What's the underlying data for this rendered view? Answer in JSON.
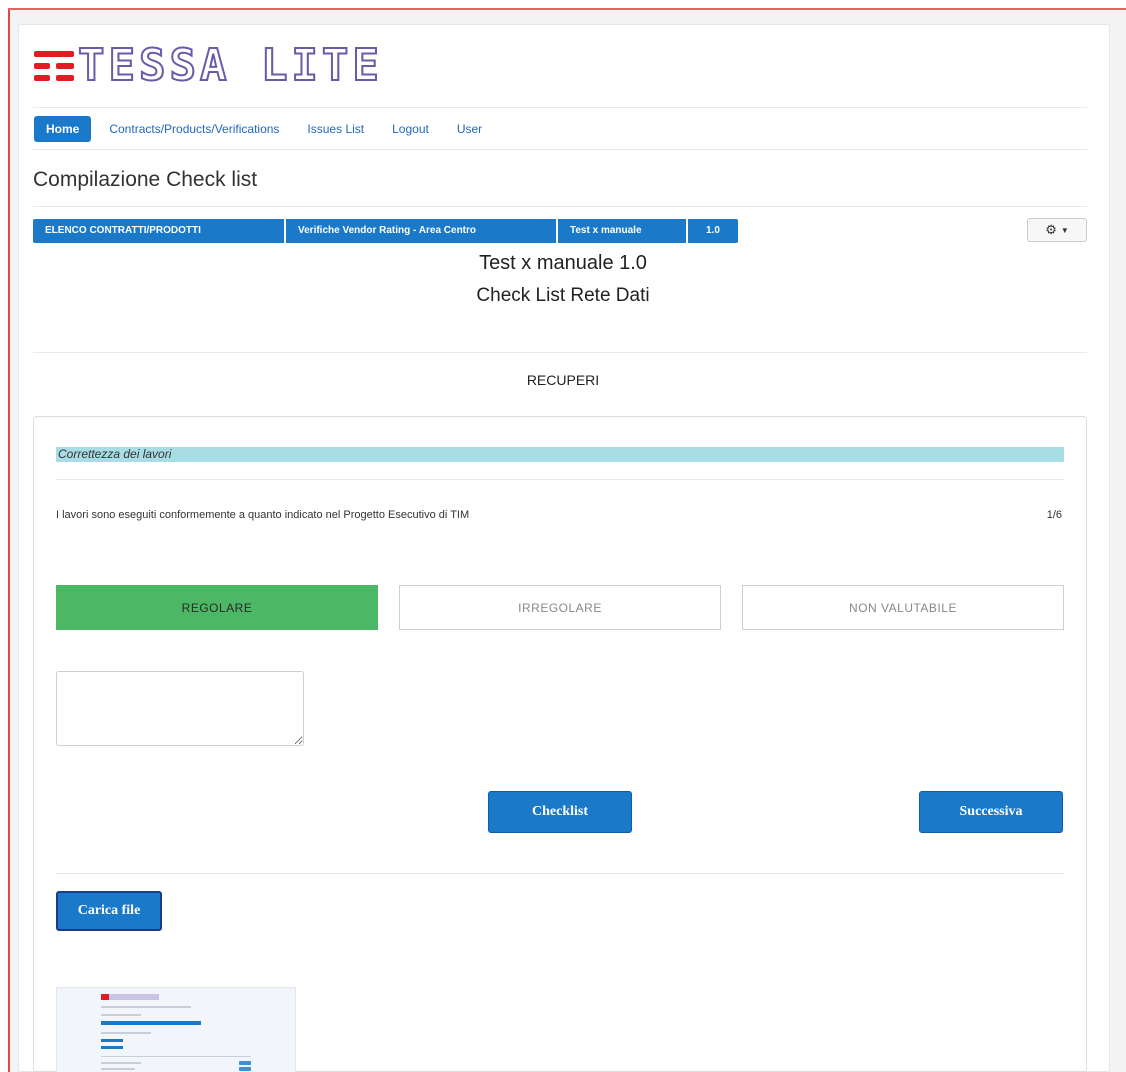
{
  "logo": {
    "text": "TESSA LITE",
    "icon": "tim-stripes-icon"
  },
  "nav": {
    "items": [
      {
        "label": "Home",
        "active": true
      },
      {
        "label": "Contracts/Products/Verifications",
        "active": false
      },
      {
        "label": "Issues List",
        "active": false
      },
      {
        "label": "Logout",
        "active": false
      },
      {
        "label": "User",
        "active": false
      }
    ]
  },
  "page_title": "Compilazione Check list",
  "breadcrumb": [
    "ELENCO CONTRATTI/PRODOTTI",
    "Verifiche Vendor Rating - Area Centro",
    "Test x manuale",
    "1.0"
  ],
  "settings_menu": {
    "icon": "gear-icon",
    "caret": "chevron-down-icon"
  },
  "header": {
    "line1": "Test x manuale 1.0",
    "line2": "Check List Rete Dati",
    "section": "RECUPERI"
  },
  "question": {
    "group": "Correttezza dei lavori",
    "text": "I lavori sono eseguiti conformemente a quanto indicato nel Progetto Esecutivo di TIM",
    "counter": "1/6",
    "options": [
      {
        "label": "REGOLARE",
        "selected": true
      },
      {
        "label": "IRREGOLARE",
        "selected": false
      },
      {
        "label": "NON VALUTABILE",
        "selected": false
      }
    ],
    "notes_value": ""
  },
  "actions": {
    "checklist_label": "Checklist",
    "next_label": "Successiva",
    "upload_label": "Carica file"
  },
  "colors": {
    "primary": "#1a79c9",
    "selected_option": "#4cb764",
    "section_bar": "#a9dde6",
    "brand_red": "#e11b22"
  }
}
